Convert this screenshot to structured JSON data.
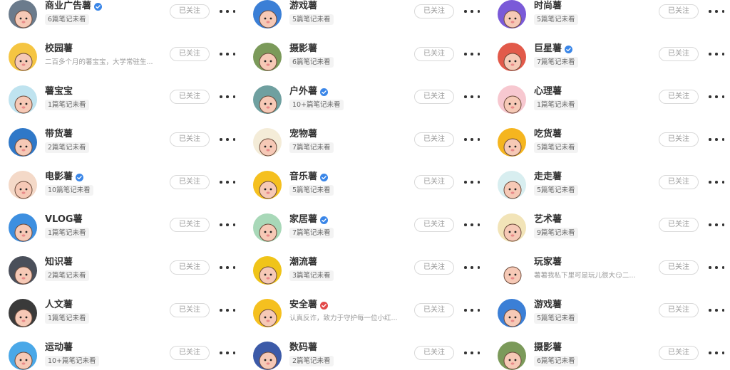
{
  "follow_label": "已关注",
  "columns": [
    [
      {
        "name": "商业广告薯",
        "verified": true,
        "sub": "6篇笔记未看",
        "sub_is_desc": false,
        "avatar_color": "#6b7b8c"
      },
      {
        "name": "校园薯",
        "verified": false,
        "sub": "二百多个月的薯宝宝，大学常驻生...",
        "sub_is_desc": true,
        "avatar_color": "#f5c542"
      },
      {
        "name": "薯宝宝",
        "verified": false,
        "sub": "1篇笔记未看",
        "sub_is_desc": false,
        "avatar_color": "#bfe3ef"
      },
      {
        "name": "带货薯",
        "verified": false,
        "sub": "2篇笔记未看",
        "sub_is_desc": false,
        "avatar_color": "#2f78c8"
      },
      {
        "name": "电影薯",
        "verified": true,
        "sub": "10篇笔记未看",
        "sub_is_desc": false,
        "avatar_color": "#f4d9c8"
      },
      {
        "name": "VLOG薯",
        "verified": false,
        "sub": "1篇笔记未看",
        "sub_is_desc": false,
        "avatar_color": "#3d8fe0"
      },
      {
        "name": "知识薯",
        "verified": false,
        "sub": "2篇笔记未看",
        "sub_is_desc": false,
        "avatar_color": "#4a4f5a"
      },
      {
        "name": "人文薯",
        "verified": false,
        "sub": "1篇笔记未看",
        "sub_is_desc": false,
        "avatar_color": "#3a3a3a"
      },
      {
        "name": "运动薯",
        "verified": false,
        "sub": "10+篇笔记未看",
        "sub_is_desc": false,
        "avatar_color": "#4aa8e8"
      }
    ],
    [
      {
        "name": "游戏薯",
        "verified": false,
        "sub": "5篇笔记未看",
        "sub_is_desc": false,
        "avatar_color": "#3b7fd6"
      },
      {
        "name": "摄影薯",
        "verified": false,
        "sub": "6篇笔记未看",
        "sub_is_desc": false,
        "avatar_color": "#7b9a5a"
      },
      {
        "name": "户外薯",
        "verified": true,
        "sub": "10+篇笔记未看",
        "sub_is_desc": false,
        "avatar_color": "#6fa0a0"
      },
      {
        "name": "宠物薯",
        "verified": false,
        "sub": "7篇笔记未看",
        "sub_is_desc": false,
        "avatar_color": "#f4ecd8"
      },
      {
        "name": "音乐薯",
        "verified": true,
        "sub": "5篇笔记未看",
        "sub_is_desc": false,
        "avatar_color": "#f5c01f"
      },
      {
        "name": "家居薯",
        "verified": true,
        "sub": "7篇笔记未看",
        "sub_is_desc": false,
        "avatar_color": "#a8d8b8"
      },
      {
        "name": "潮流薯",
        "verified": false,
        "sub": "3篇笔记未看",
        "sub_is_desc": false,
        "avatar_color": "#f0c419"
      },
      {
        "name": "安全薯",
        "verified": true,
        "verified_red": true,
        "sub": "认真反诈，致力于守护每一位小红...",
        "sub_is_desc": true,
        "avatar_color": "#f5c01f"
      },
      {
        "name": "数码薯",
        "verified": false,
        "sub": "2篇笔记未看",
        "sub_is_desc": false,
        "avatar_color": "#3c5aa8"
      }
    ],
    [
      {
        "name": "时尚薯",
        "verified": false,
        "sub": "5篇笔记未看",
        "sub_is_desc": false,
        "avatar_color": "#7a5ad8"
      },
      {
        "name": "巨星薯",
        "verified": true,
        "sub": "7篇笔记未看",
        "sub_is_desc": false,
        "avatar_color": "#e25a4a"
      },
      {
        "name": "心理薯",
        "verified": false,
        "sub": "1篇笔记未看",
        "sub_is_desc": false,
        "avatar_color": "#f7c8d0"
      },
      {
        "name": "吃货薯",
        "verified": false,
        "sub": "5篇笔记未看",
        "sub_is_desc": false,
        "avatar_color": "#f5b51f"
      },
      {
        "name": "走走薯",
        "verified": false,
        "sub": "5篇笔记未看",
        "sub_is_desc": false,
        "avatar_color": "#d8eef0"
      },
      {
        "name": "艺术薯",
        "verified": false,
        "sub": "9篇笔记未看",
        "sub_is_desc": false,
        "avatar_color": "#f2e4b8"
      },
      {
        "name": "玩家薯",
        "verified": false,
        "sub": "薯薯我私下里可是玩儿很大😏二...",
        "sub_is_desc": true,
        "avatar_color": "#ffffff"
      },
      {
        "name": "游戏薯",
        "verified": false,
        "sub": "5篇笔记未看",
        "sub_is_desc": false,
        "avatar_color": "#3b7fd6"
      },
      {
        "name": "摄影薯",
        "verified": false,
        "sub": "6篇笔记未看",
        "sub_is_desc": false,
        "avatar_color": "#7b9a5a"
      }
    ]
  ]
}
